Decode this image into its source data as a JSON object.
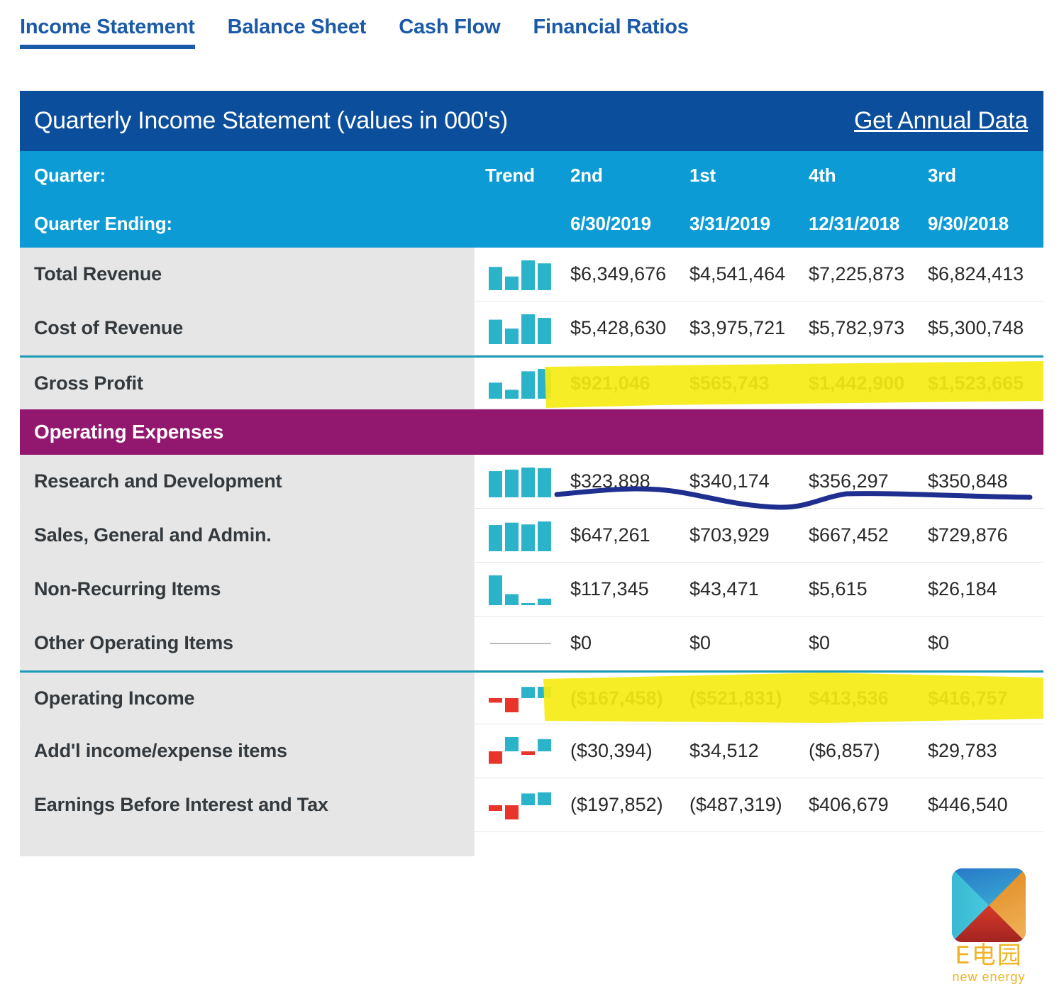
{
  "tabs": [
    {
      "label": "Income Statement",
      "active": true
    },
    {
      "label": "Balance Sheet",
      "active": false
    },
    {
      "label": "Cash Flow",
      "active": false
    },
    {
      "label": "Financial Ratios",
      "active": false
    }
  ],
  "panel": {
    "title": "Quarterly Income Statement (values in 000's)",
    "annual_link": "Get Annual Data",
    "quarter_label": "Quarter:",
    "quarter_ending_label": "Quarter Ending:",
    "trend_label": "Trend",
    "quarters": [
      "2nd",
      "1st",
      "4th",
      "3rd"
    ],
    "quarter_endings": [
      "6/30/2019",
      "3/31/2019",
      "12/31/2018",
      "9/30/2018"
    ],
    "section_operating_expenses": "Operating Expenses"
  },
  "colors": {
    "title_bar": "#0b4e9b",
    "sub_head": "#0c9bd5",
    "section_band": "#92186f",
    "label_col": "#e6e6e6",
    "tab_blue": "#1b5aa8",
    "spark_positive": "#2bb3c9",
    "spark_negative": "#e8342a",
    "subtotal_rule": "#1b9bb5",
    "highlight_yellow": "#f5ec14",
    "annotation_blue": "#1f2f8f",
    "logo_gold": "#f0b323"
  },
  "chart_data": {
    "type": "table",
    "title": "Quarterly Income Statement (values in 000's)",
    "categories": [
      "6/30/2019",
      "3/31/2019",
      "12/31/2018",
      "9/30/2018"
    ],
    "rows": [
      {
        "name": "Total Revenue",
        "values": [
          6349676,
          4541464,
          7225873,
          6824413
        ]
      },
      {
        "name": "Cost of Revenue",
        "values": [
          5428630,
          3975721,
          5782973,
          5300748
        ]
      },
      {
        "name": "Gross Profit",
        "values": [
          921046,
          565743,
          1442900,
          1523665
        ]
      },
      {
        "name": "Research and Development",
        "values": [
          323898,
          340174,
          356297,
          350848
        ]
      },
      {
        "name": "Sales, General and Admin.",
        "values": [
          647261,
          703929,
          667452,
          729876
        ]
      },
      {
        "name": "Non-Recurring Items",
        "values": [
          117345,
          43471,
          5615,
          26184
        ]
      },
      {
        "name": "Other Operating Items",
        "values": [
          0,
          0,
          0,
          0
        ]
      },
      {
        "name": "Operating Income",
        "values": [
          -167458,
          -521831,
          413536,
          416757
        ]
      },
      {
        "name": "Add'l income/expense items",
        "values": [
          -30394,
          34512,
          -6857,
          29783
        ]
      },
      {
        "name": "Earnings Before Interest and Tax",
        "values": [
          -197852,
          -487319,
          406679,
          446540
        ]
      }
    ]
  },
  "table_rows": [
    {
      "label": "Total Revenue",
      "trend": "bar-sparkline",
      "subtotal": false,
      "highlight": false,
      "values": [
        "$6,349,676",
        "$4,541,464",
        "$7,225,873",
        "$6,824,413"
      ],
      "bars": [
        78,
        46,
        100,
        90
      ],
      "signs": [
        1,
        1,
        1,
        1
      ]
    },
    {
      "label": "Cost of Revenue",
      "trend": "bar-sparkline",
      "subtotal": false,
      "highlight": false,
      "values": [
        "$5,428,630",
        "$3,975,721",
        "$5,782,973",
        "$5,300,748"
      ],
      "bars": [
        82,
        52,
        100,
        88
      ],
      "signs": [
        1,
        1,
        1,
        1
      ]
    },
    {
      "label": "Gross Profit",
      "trend": "bar-sparkline",
      "subtotal": true,
      "highlight": true,
      "values": [
        "$921,046",
        "$565,743",
        "$1,442,900",
        "$1,523,665"
      ],
      "bars": [
        54,
        30,
        92,
        100
      ],
      "signs": [
        1,
        1,
        1,
        1
      ]
    },
    {
      "label": "Research and Development",
      "trend": "bar-sparkline",
      "subtotal": false,
      "highlight": false,
      "values": [
        "$323,898",
        "$340,174",
        "$356,297",
        "$350,848"
      ],
      "bars": [
        88,
        93,
        100,
        98
      ],
      "signs": [
        1,
        1,
        1,
        1
      ]
    },
    {
      "label": "Sales, General and Admin.",
      "trend": "bar-sparkline",
      "subtotal": false,
      "highlight": false,
      "values": [
        "$647,261",
        "$703,929",
        "$667,452",
        "$729,876"
      ],
      "bars": [
        88,
        96,
        90,
        100
      ],
      "signs": [
        1,
        1,
        1,
        1
      ]
    },
    {
      "label": "Non-Recurring Items",
      "trend": "bar-sparkline",
      "subtotal": false,
      "highlight": false,
      "values": [
        "$117,345",
        "$43,471",
        "$5,615",
        "$26,184"
      ],
      "bars": [
        100,
        37,
        5,
        22
      ],
      "signs": [
        1,
        1,
        1,
        1
      ]
    },
    {
      "label": "Other Operating Items",
      "trend": "flat-line",
      "subtotal": false,
      "highlight": false,
      "values": [
        "$0",
        "$0",
        "$0",
        "$0"
      ],
      "bars": [
        0,
        0,
        0,
        0
      ],
      "signs": [
        1,
        1,
        1,
        1
      ]
    },
    {
      "label": "Operating Income",
      "trend": "waterfall-sparkline",
      "subtotal": true,
      "highlight": true,
      "values": [
        "($167,458)",
        "($521,831)",
        "$413,536",
        "$416,757"
      ],
      "bars": [
        32,
        100,
        79,
        80
      ],
      "signs": [
        -1,
        -1,
        1,
        1
      ]
    },
    {
      "label": "Add'l income/expense items",
      "trend": "waterfall-sparkline",
      "subtotal": false,
      "highlight": false,
      "values": [
        "($30,394)",
        "$34,512",
        "($6,857)",
        "$29,783"
      ],
      "bars": [
        88,
        100,
        20,
        86
      ],
      "signs": [
        -1,
        1,
        -1,
        1
      ]
    },
    {
      "label": "Earnings Before Interest and Tax",
      "trend": "waterfall-sparkline",
      "subtotal": false,
      "highlight": false,
      "values": [
        "($197,852)",
        "($487,319)",
        "$406,679",
        "$446,540"
      ],
      "bars": [
        40,
        100,
        83,
        91
      ],
      "signs": [
        -1,
        -1,
        1,
        1
      ]
    }
  ],
  "annotations": {
    "gross_profit_highlight": "yellow-marker-stroke",
    "operating_income_highlight": "yellow-marker-stroke",
    "rnd_trend_curve": "blue-pen-curve"
  },
  "logo": {
    "cn_text": "E电园",
    "en_text": "new energy"
  }
}
